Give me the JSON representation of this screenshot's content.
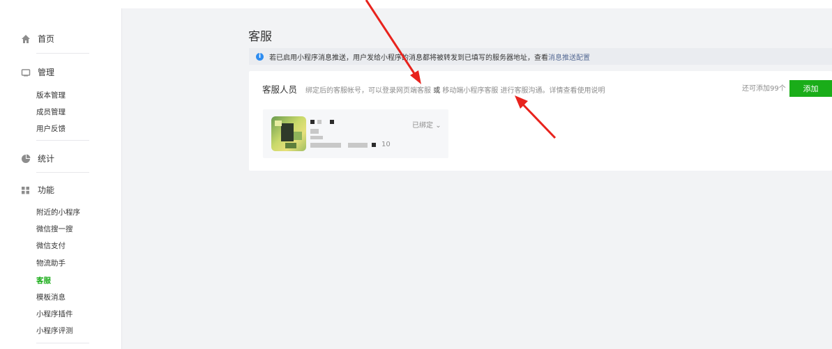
{
  "sidebar": {
    "home": "首页",
    "manage": {
      "title": "管理",
      "items": [
        "版本管理",
        "成员管理",
        "用户反馈"
      ]
    },
    "stats": "统计",
    "features": {
      "title": "功能",
      "items": [
        "附近的小程序",
        "微信搜一搜",
        "微信支付",
        "物流助手",
        "客服",
        "模板消息",
        "小程序插件",
        "小程序评测"
      ]
    }
  },
  "page_title": "客服",
  "notice": {
    "text": "若已启用小程序消息推送，用户发给小程序的消息都将被转发到已填写的服务器地址，查看 ",
    "link": "消息推送配置"
  },
  "panel": {
    "title": "客服人员",
    "desc_prefix": "绑定后的客服帐号，可以登录",
    "link_web": "网页端客服",
    "or": " 或 ",
    "link_mobile": "移动端小程序客服",
    "desc_mid": " 进行客服沟通。详情查看",
    "link_help": "使用说明",
    "remain": "还可添加99个",
    "add_label": "添加"
  },
  "card": {
    "status": "已绑定",
    "number_tail": "10"
  },
  "colors": {
    "accent": "#1aad19",
    "link": "#576b95",
    "arrow": "#e8231d"
  }
}
